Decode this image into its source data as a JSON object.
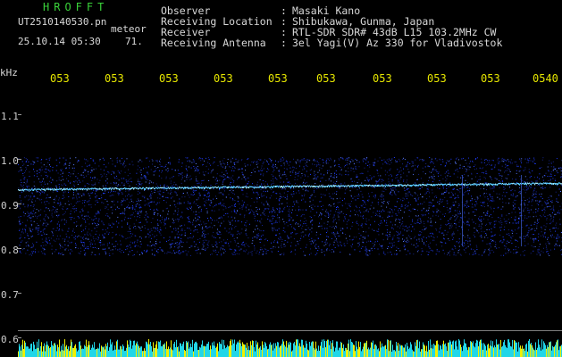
{
  "header": {
    "brand": "HROFFT",
    "filename": "UT2510140530.pn",
    "mode": "meteor",
    "datetime": "25.10.14 05:30",
    "count": "71."
  },
  "info": [
    {
      "label": "Observer",
      "value": "Masaki Kano"
    },
    {
      "label": "Receiving Location",
      "value": "Shibukawa, Gunma, Japan"
    },
    {
      "label": "Receiver",
      "value": "RTL-SDR SDR# 43dB L15 103.2MHz CW"
    },
    {
      "label": "Receiving Antenna",
      "value": "3el Yagi(V) Az 330 for Vladivostok"
    }
  ],
  "separator": ":",
  "axis": {
    "unit": "kHz",
    "y_ticks": [
      "1.1",
      "1.0",
      "0.9",
      "0.8",
      "0.7",
      "0.6"
    ],
    "time_labels": [
      "053",
      "053",
      "053",
      "053",
      "053",
      "053",
      "053",
      "053",
      "053",
      "0540"
    ]
  },
  "colors": {
    "background": "#000000",
    "brand": "#3ad23a",
    "time_labels": "#e6e600",
    "noise": "#1f3cff",
    "trace": "#55c8ff",
    "bottom_band_cyan": "#21d6e8",
    "bottom_band_yellow": "#f0f000"
  }
}
